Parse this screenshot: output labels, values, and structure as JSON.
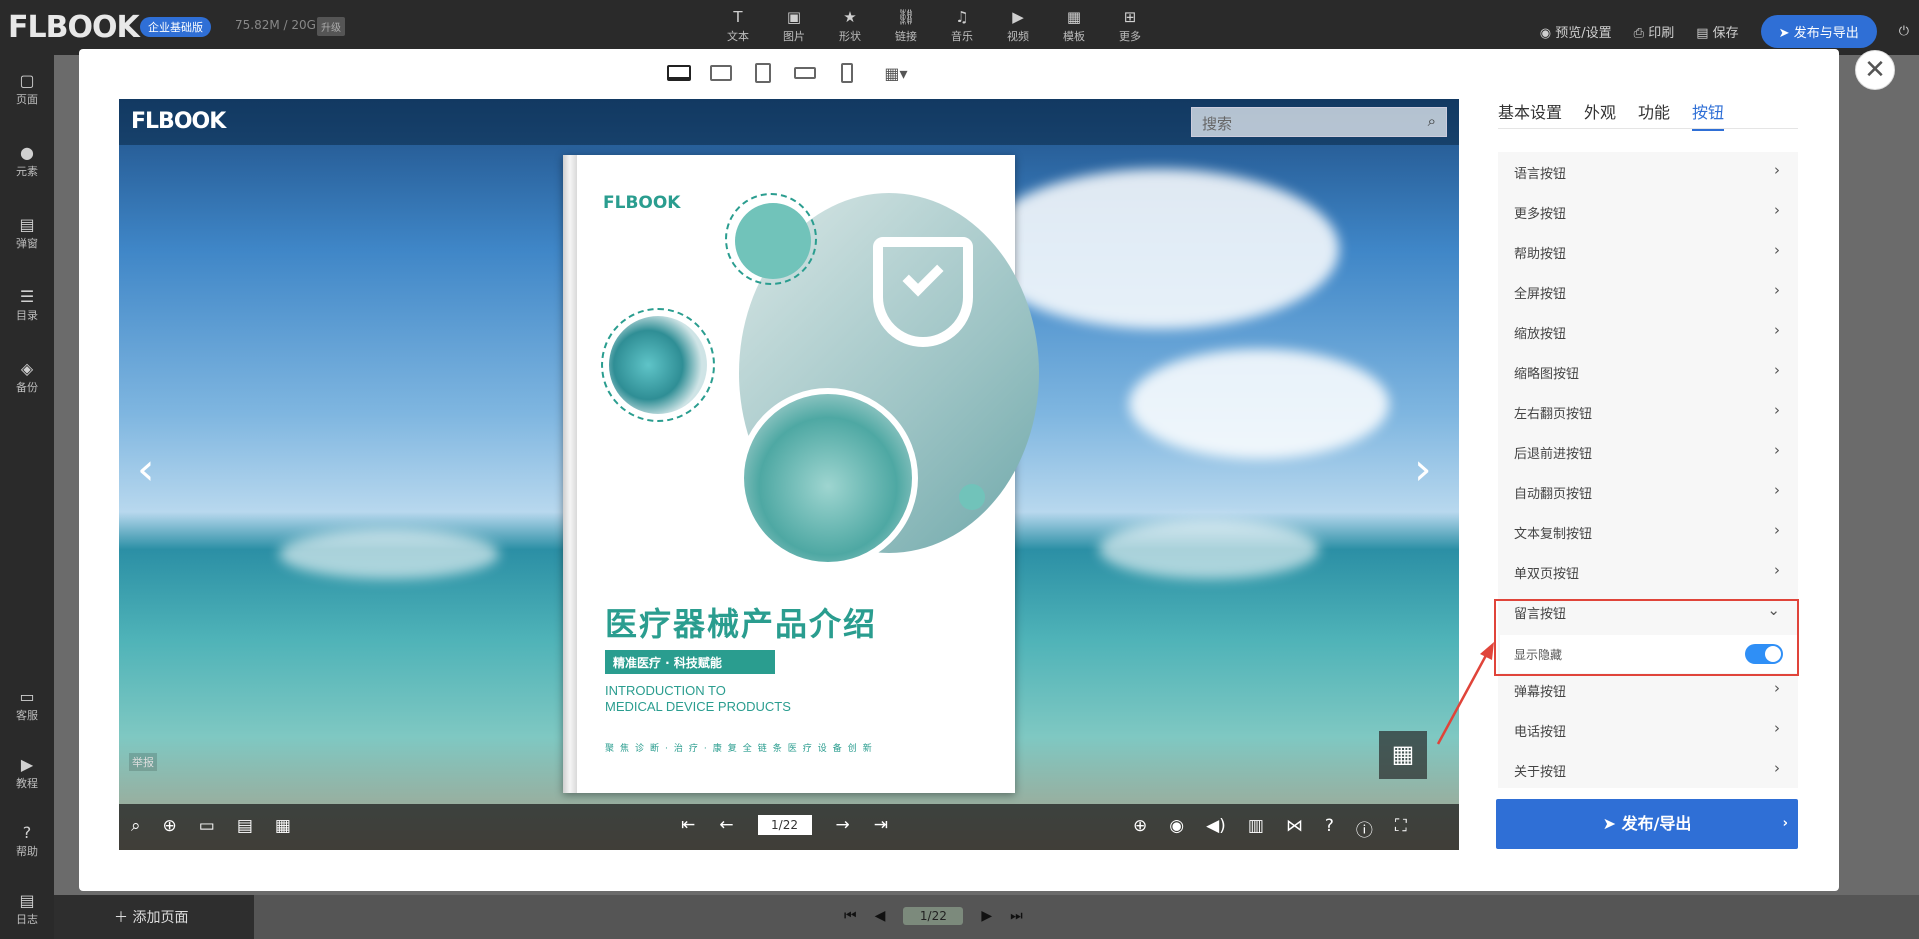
{
  "app": {
    "logo": "FLBOOK",
    "edition_badge": "企业基础版",
    "storage": "75.82M / 20G",
    "upgrade": "升级",
    "tools": [
      {
        "label": "文本",
        "icon": "text-icon"
      },
      {
        "label": "图片",
        "icon": "image-icon"
      },
      {
        "label": "形状",
        "icon": "shape-icon"
      },
      {
        "label": "链接",
        "icon": "link-icon"
      },
      {
        "label": "音乐",
        "icon": "music-icon"
      },
      {
        "label": "视频",
        "icon": "video-icon"
      },
      {
        "label": "模板",
        "icon": "template-icon"
      },
      {
        "label": "更多",
        "icon": "more-icon"
      }
    ],
    "top_actions": {
      "preview": "预览/设置",
      "print": "印刷",
      "save": "保存",
      "publish": "发布与导出"
    },
    "sidebar": [
      {
        "label": "页面"
      },
      {
        "label": "元素"
      },
      {
        "label": "弹窗"
      },
      {
        "label": "目录"
      },
      {
        "label": "备份"
      },
      {
        "label": "客服"
      },
      {
        "label": "教程"
      },
      {
        "label": "帮助"
      },
      {
        "label": "日志"
      }
    ],
    "bottom": {
      "add_page": "添加页面",
      "page": "1/22"
    }
  },
  "preview": {
    "logo": "FLBOOK",
    "search_placeholder": "搜索",
    "report": "举报",
    "page_indicator": "1/22",
    "book": {
      "logo": "FLBOOK",
      "title": "医疗器械产品介绍",
      "tag": "精准医疗 · 科技赋能",
      "en_line1": "INTRODUCTION TO",
      "en_line2": "MEDICAL DEVICE PRODUCTS",
      "footer": "聚焦诊断·治疗·康复全链条医疗设备创新"
    }
  },
  "panel": {
    "tabs": [
      "基本设置",
      "外观",
      "功能",
      "按钮"
    ],
    "active_tab": "按钮",
    "rows": [
      "语言按钮",
      "更多按钮",
      "帮助按钮",
      "全屏按钮",
      "缩放按钮",
      "缩略图按钮",
      "左右翻页按钮",
      "后退前进按钮",
      "自动翻页按钮",
      "文本复制按钮",
      "单双页按钮"
    ],
    "expanded_row": "留言按钮",
    "sub_label": "显示隐藏",
    "toggle_on": true,
    "rows_after": [
      "弹幕按钮",
      "电话按钮",
      "关于按钮"
    ],
    "publish_label": "发布/导出"
  },
  "colors": {
    "accent": "#2f6fd6",
    "highlight_border": "#e0443a",
    "toggle": "#2f8ff6"
  }
}
